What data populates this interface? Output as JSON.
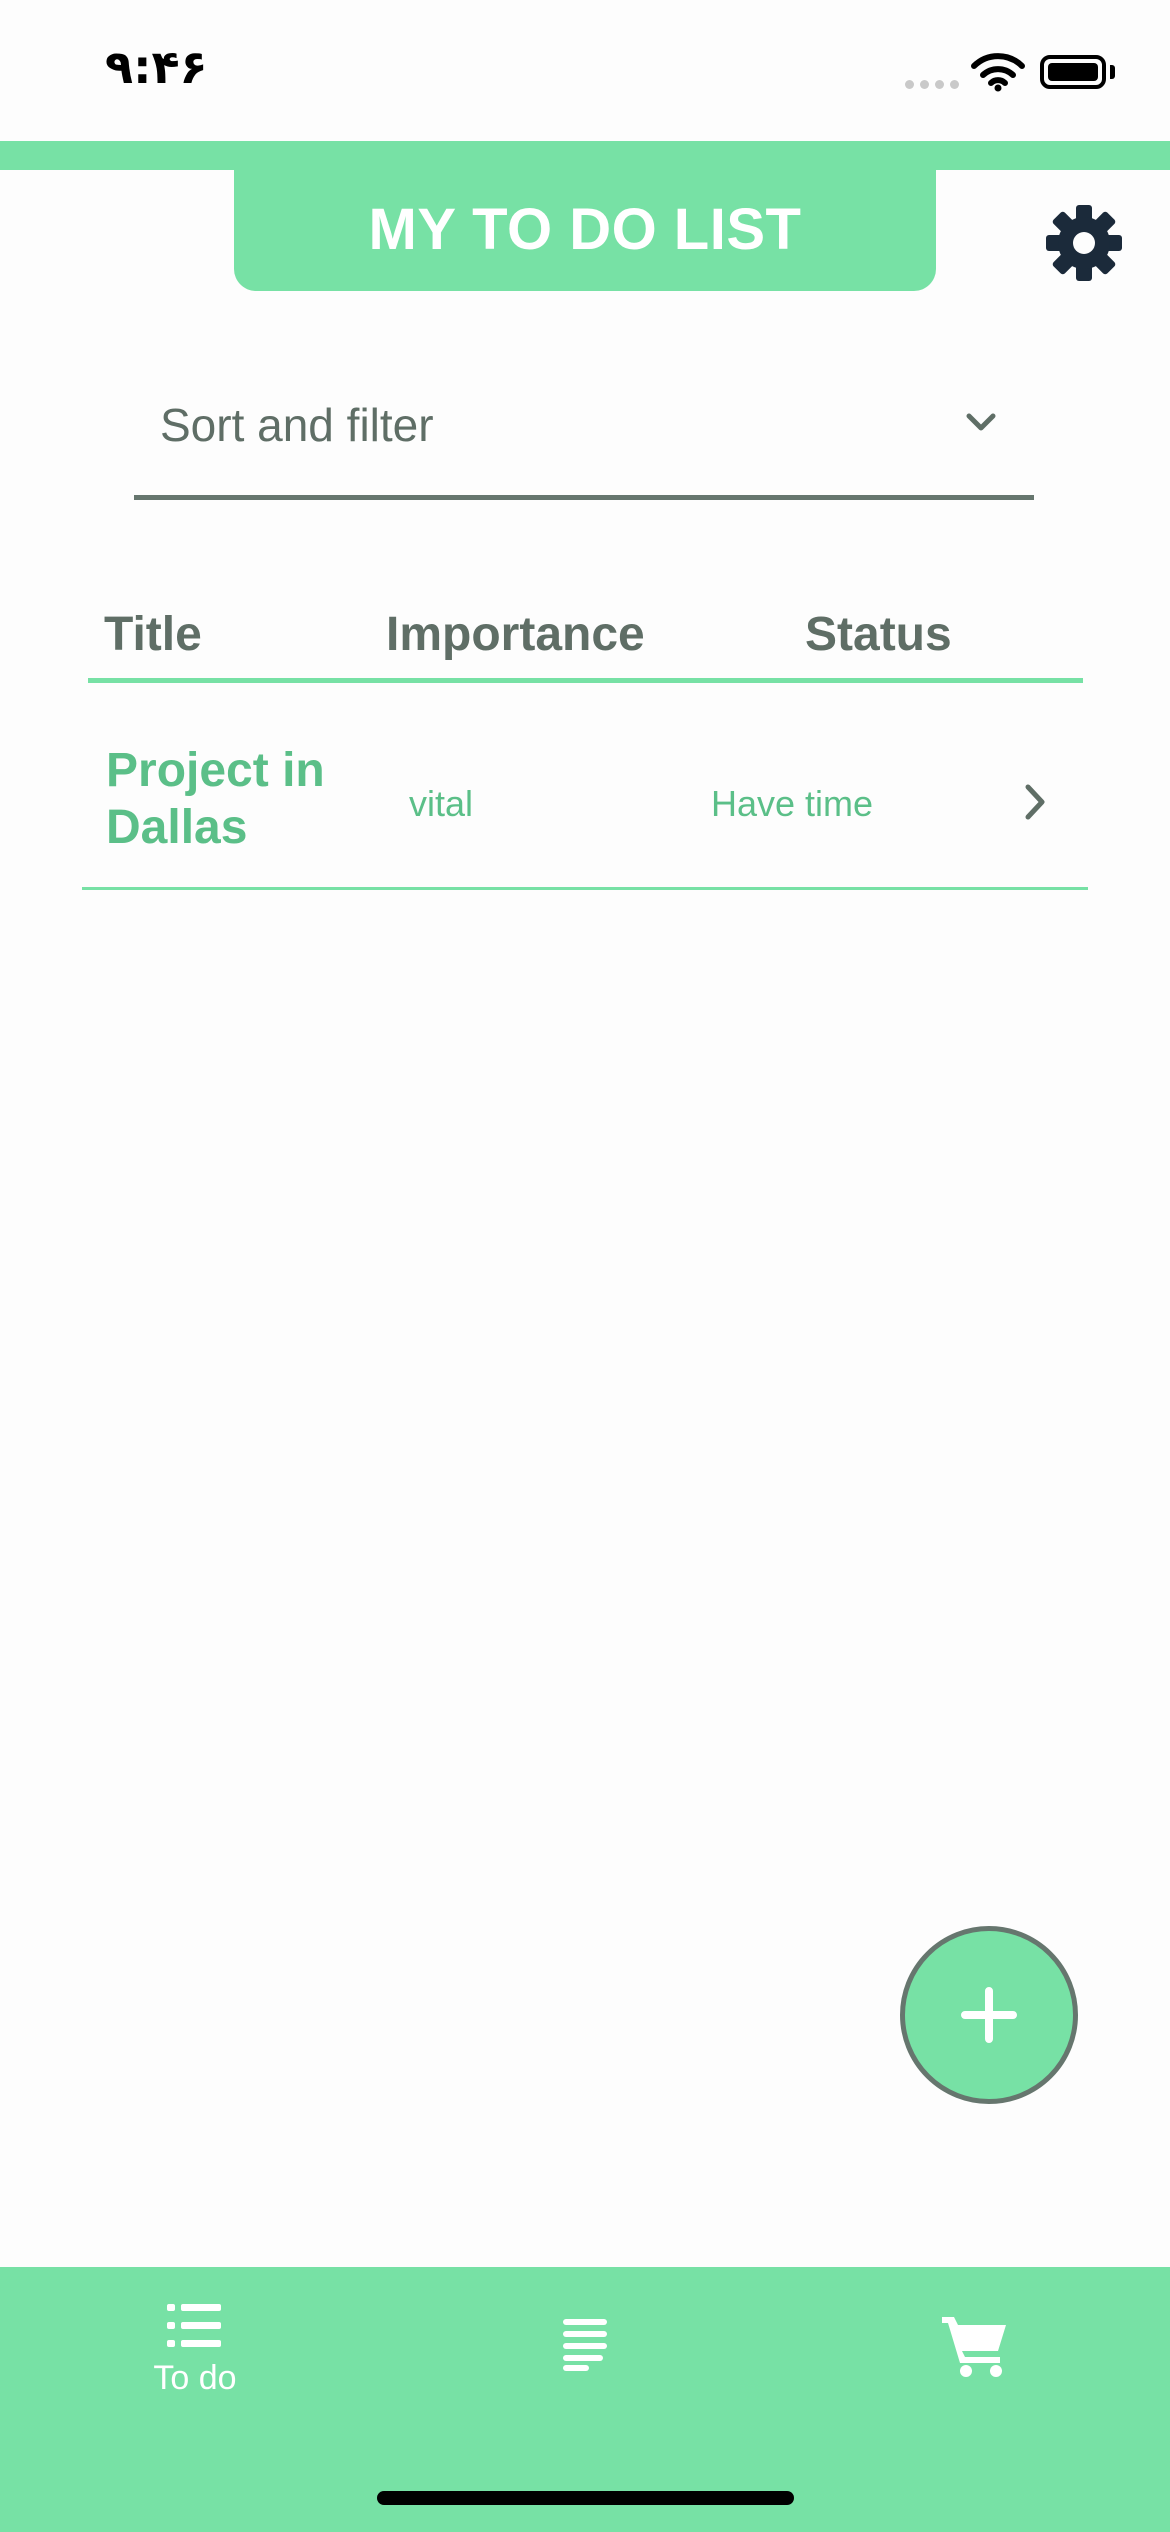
{
  "status_bar": {
    "time": "۹:۴۶"
  },
  "header": {
    "title": "MY TO DO LIST"
  },
  "sort_filter": {
    "label": "Sort and filter"
  },
  "table": {
    "columns": [
      "Title",
      "Importance",
      "Status"
    ],
    "rows": [
      {
        "title": "Project in Dallas",
        "importance": "vital",
        "status": "Have time"
      }
    ]
  },
  "bottom_nav": {
    "items": [
      {
        "label": "To do",
        "icon": "list-icon"
      },
      {
        "label": "",
        "icon": "notes-icon"
      },
      {
        "label": "",
        "icon": "cart-icon"
      }
    ]
  },
  "colors": {
    "accent": "#77e1a5",
    "text_primary": "#5f6e66",
    "text_accent": "#5bbf88",
    "gear": "#1b2a3a"
  }
}
